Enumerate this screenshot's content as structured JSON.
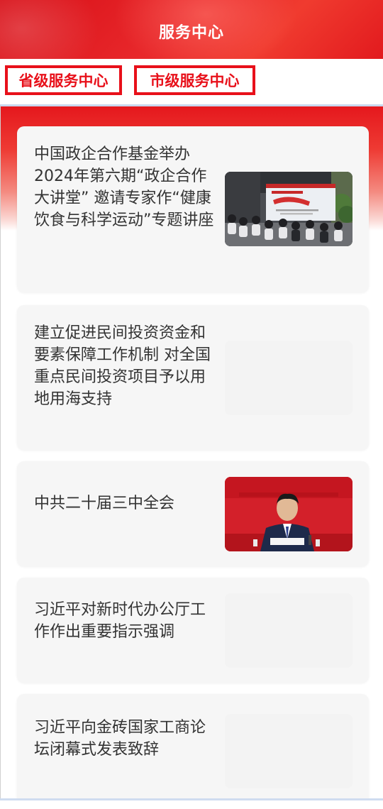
{
  "header": {
    "title": "服务中心"
  },
  "tabs": [
    {
      "label": "省级服务中心"
    },
    {
      "label": "市级服务中心"
    }
  ],
  "news": [
    {
      "title": "中国政企合作基金举办2024年第六期“政企合作大讲堂” 邀请专家作“健康饮食与科学运动”专题讲座",
      "thumb": "lecture-photo"
    },
    {
      "title": "建立促进民间投资资金和要素保障工作机制 对全国重点民间投资项目予以用地用海支持",
      "thumb": "blank"
    },
    {
      "title": "中共二十届三中全会",
      "thumb": "plenary-photo"
    },
    {
      "title": "习近平对新时代办公厅工作作出重要指示强调",
      "thumb": "blank"
    },
    {
      "title": "习近平向金砖国家工商论坛闭幕式发表致辞",
      "thumb": "blank"
    }
  ],
  "colors": {
    "brand_red": "#e8101a",
    "card_bg": "#f6f6f6",
    "text": "#333333"
  }
}
